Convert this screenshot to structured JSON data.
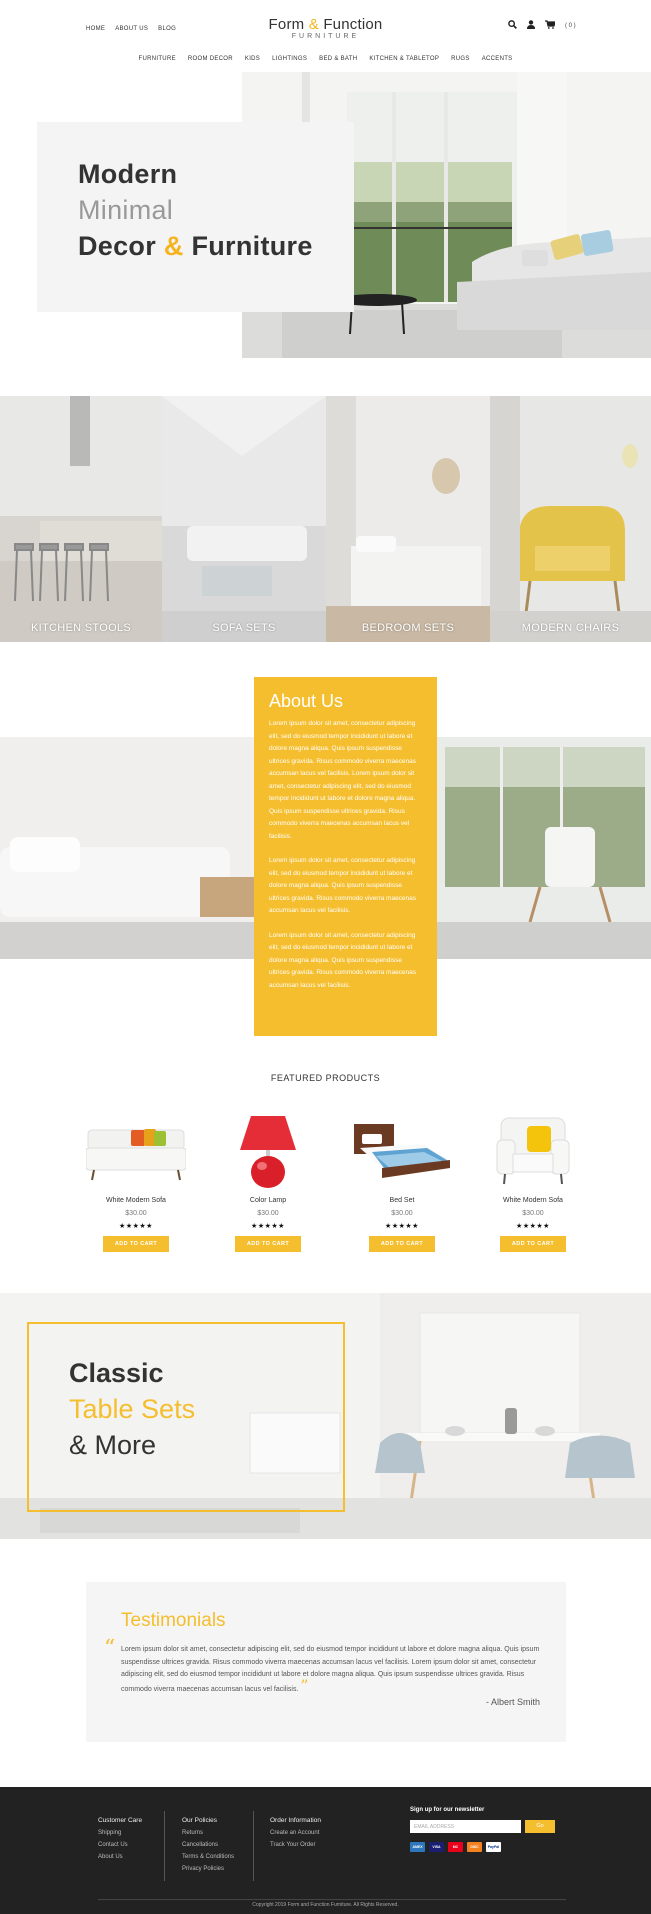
{
  "header": {
    "top_links": [
      "HOME",
      "ABOUT US",
      "BLOG"
    ],
    "logo_main_1": "Form",
    "logo_amp": "&",
    "logo_main_2": "Function",
    "logo_sub": "FURNITURE",
    "cart_count": "( 0 )",
    "icons": [
      "search-icon",
      "user-icon",
      "cart-icon"
    ]
  },
  "category_nav": [
    "FURNITURE",
    "ROOM DECOR",
    "KIDS",
    "LIGHTINGS",
    "BED & BATH",
    "KITCHEN & TABLETOP",
    "RUGS",
    "ACCENTS"
  ],
  "hero": {
    "line1": "Modern",
    "line2": "Minimal",
    "line3_a": "Decor",
    "line3_amp": "&",
    "line3_b": "Furniture"
  },
  "categories": [
    "KITCHEN STOOLS",
    "SOFA SETS",
    "BEDROOM SETS",
    "MODERN CHAIRS"
  ],
  "about": {
    "title": "About Us",
    "p1": "Lorem ipsum dolor sit amet, consectetur adipiscing elit, sed do eiusmod tempor incididunt ut labore et dolore magna aliqua. Quis ipsum suspendisse ultrices gravida. Risus commodo viverra maecenas accumsan lacus vel facilisis. Lorem ipsum dolor sit amet, consectetur adipiscing elit, sed do eiusmod tempor incididunt ut labore et dolore magna aliqua. Quis ipsum suspendisse ultrices gravida. Risus commodo viverra maecenas accumsan lacus vel facilisis.",
    "p2": "Lorem ipsum dolor sit amet, consectetur adipiscing elit, sed do eiusmod tempor incididunt ut labore et dolore magna aliqua. Quis ipsum suspendisse ultrices gravida. Risus commodo viverra maecenas accumsan lacus vel facilisis.",
    "p3": "Lorem ipsum dolor sit amet, consectetur adipiscing elit, sed do eiusmod tempor incididunt ut labore et dolore magna aliqua. Quis ipsum suspendisse ultrices gravida. Risus commodo viverra maecenas accumsan lacus vel facilisis."
  },
  "featured": {
    "title": "FEATURED PRODUCTS",
    "products": [
      {
        "name": "White Modern Sofa",
        "price": "$30.00",
        "stars": "★★★★★",
        "button": "ADD TO CART",
        "rating": 5
      },
      {
        "name": "Color Lamp",
        "price": "$30.00",
        "stars": "★★★★★",
        "button": "ADD TO CART",
        "rating": 5
      },
      {
        "name": "Bed Set",
        "price": "$30.00",
        "stars": "★★★★★",
        "button": "ADD TO CART",
        "rating": 5
      },
      {
        "name": "White Modern Sofa",
        "price": "$30.00",
        "stars": "★★★★★",
        "button": "ADD TO CART",
        "rating": 5
      }
    ]
  },
  "classic": {
    "line1": "Classic",
    "line2": "Table Sets",
    "line3": "& More"
  },
  "testimonials": {
    "title": "Testimonials",
    "open_quote": "“",
    "close_quote": "”",
    "text": "Lorem ipsum dolor sit amet, consectetur adipiscing elit, sed do eiusmod tempor incididunt ut labore et dolore magna aliqua. Quis ipsum suspendisse ultrices gravida. Risus commodo viverra maecenas accumsan lacus vel facilisis.  Lorem ipsum dolor sit amet, consectetur adipiscing elit, sed do eiusmod tempor incididunt ut labore et dolore magna aliqua. Quis ipsum suspendisse ultrices gravida. Risus commodo viverra maecenas accumsan lacus vel facilisis.",
    "author": "- Albert Smith"
  },
  "footer": {
    "customer_care": {
      "title": "Customer Care",
      "items": [
        "Shipping",
        "Contact Us",
        "About Us"
      ]
    },
    "policies": {
      "title": "Our Policies",
      "items": [
        "Returns",
        "Cancellations",
        "Terms & Conditions",
        "Privacy Policies"
      ]
    },
    "order": {
      "title": "Order Information",
      "items": [
        "Create an Account",
        "Track Your Order"
      ]
    },
    "newsletter_title": "Sign up for our newsletter",
    "email_placeholder": "EMAIL ADDRESS",
    "go_label": "Go",
    "payment_cards": [
      "AMEX",
      "VISA",
      "MC",
      "DISC",
      "PayPal"
    ],
    "copyright": "Copyright 2019 Form and Function Furniture. All Rights Reserved."
  },
  "colors": {
    "accent": "#f5be2e",
    "footer_bg": "#222222"
  }
}
